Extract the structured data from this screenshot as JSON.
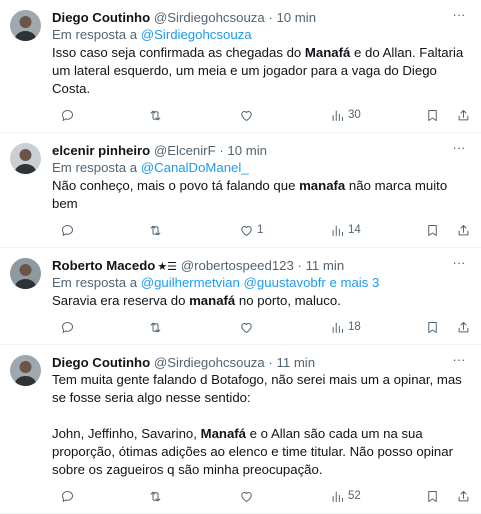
{
  "tweets": [
    {
      "name": "Diego Coutinho",
      "verified": "",
      "handle": "@Sirdiegohcsouza",
      "dot": "·",
      "time": "10 min",
      "reply_prefix": "Em resposta a",
      "reply_to": "@Sirdiegohcsouza",
      "body": [
        "Isso caso seja confirmada as chegadas do ",
        "Manafá",
        " e do Allan. Faltaria um lateral esquerdo, um meia e um jogador para a vaga do Diego Costa."
      ],
      "likes": "",
      "views": "30",
      "avatar_bg": "#9fa8ae"
    },
    {
      "name": "elcenir pinheiro",
      "verified": "",
      "handle": "@ElcenirF",
      "dot": "·",
      "time": "10 min",
      "reply_prefix": "Em resposta a",
      "reply_to": "@CanalDoManel_",
      "body": [
        "Não conheço, mais o povo tá falando que ",
        "manafa",
        " não marca muito bem"
      ],
      "likes": "1",
      "views": "14",
      "avatar_bg": "#c9cfd3"
    },
    {
      "name": "Roberto Macedo",
      "verified": "★☰",
      "handle": "@robertospeed123",
      "dot": "·",
      "time": "11 min",
      "reply_prefix": "Em resposta a",
      "reply_to": "@guilhermetvian @guustavobfr e mais 3",
      "body": [
        "Saravia era reserva do ",
        "manafá",
        " no porto, maluco."
      ],
      "likes": "",
      "views": "18",
      "avatar_bg": "#8e9aa0"
    },
    {
      "name": "Diego Coutinho",
      "verified": "",
      "handle": "@Sirdiegohcsouza",
      "dot": "·",
      "time": "11 min",
      "reply_prefix": "",
      "reply_to": "",
      "body": [
        "Tem muita gente falando d Botafogo, não serei mais um a opinar, mas se fosse seria algo nesse sentido:\n\nJohn, Jeffinho, Savarino, ",
        "Manafá",
        " e o Allan são cada um na sua proporção, ótimas adições ao elenco e time titular. Não posso opinar sobre os zagueiros q são minha preocupação."
      ],
      "likes": "",
      "views": "52",
      "avatar_bg": "#9fa8ae"
    }
  ],
  "icons": {
    "more": "more-icon",
    "reply": "reply-icon",
    "retweet": "retweet-icon",
    "like": "heart-icon",
    "views": "views-icon",
    "bookmark": "bookmark-icon",
    "share": "share-icon"
  },
  "colors": {
    "link": "#1d9bf0",
    "secondary_text": "#536471",
    "divider": "#eff3f4"
  }
}
